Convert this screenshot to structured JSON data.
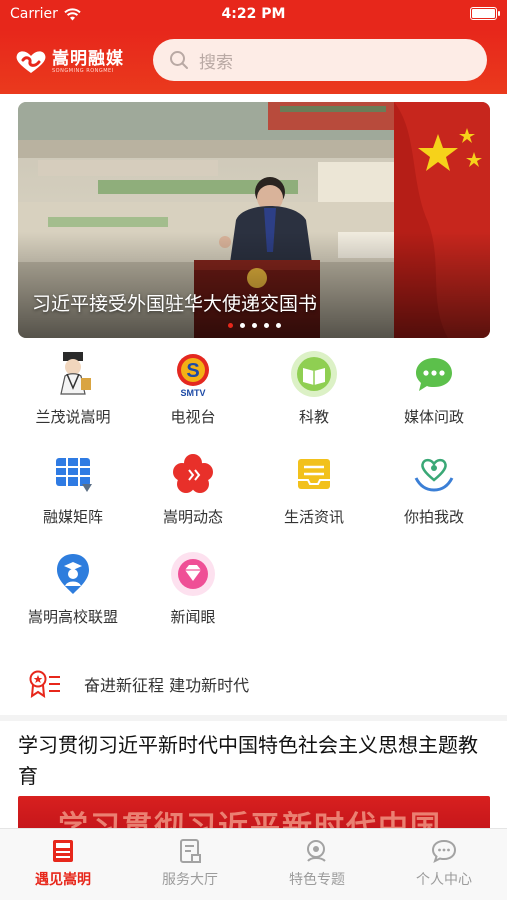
{
  "status_bar": {
    "carrier": "Carrier",
    "time": "4:22 PM"
  },
  "header": {
    "logo_text": "嵩明融媒",
    "logo_subtext": "SONGMING RONGMEI",
    "search_placeholder": "搜索"
  },
  "banner": {
    "caption": "习近平接受外国驻华大使递交国书",
    "slide_count": 5,
    "active_slide": 1
  },
  "grid": [
    {
      "label": "兰茂说嵩明",
      "icon": "scholar-icon"
    },
    {
      "label": "电视台",
      "icon": "smtv-logo-icon",
      "icon_text": "SMTV"
    },
    {
      "label": "科教",
      "icon": "book-icon"
    },
    {
      "label": "媒体问政",
      "icon": "chat-bubble-icon"
    },
    {
      "label": "融媒矩阵",
      "icon": "matrix-grid-icon"
    },
    {
      "label": "嵩明动态",
      "icon": "flower-play-icon"
    },
    {
      "label": "生活资讯",
      "icon": "news-tray-icon"
    },
    {
      "label": "你拍我改",
      "icon": "heart-hands-icon"
    },
    {
      "label": "嵩明高校联盟",
      "icon": "graduate-icon"
    },
    {
      "label": "新闻眼",
      "icon": "diamond-eye-icon"
    }
  ],
  "slogan": {
    "text": "奋进新征程 建功新时代",
    "icon": "badge-list-icon"
  },
  "article": {
    "title": "学习贯彻习近平新时代中国特色社会主义思想主题教育",
    "image_text": "学习贯彻习近平新时代中国"
  },
  "tabs": [
    {
      "label": "遇见嵩明",
      "icon": "news-paper-icon",
      "active": true
    },
    {
      "label": "服务大厅",
      "icon": "service-doc-icon",
      "active": false
    },
    {
      "label": "特色专题",
      "icon": "topic-search-icon",
      "active": false
    },
    {
      "label": "个人中心",
      "icon": "profile-chat-icon",
      "active": false
    }
  ],
  "colors": {
    "brand_red": "#e7271b",
    "inactive_gray": "#9c9c9c"
  }
}
